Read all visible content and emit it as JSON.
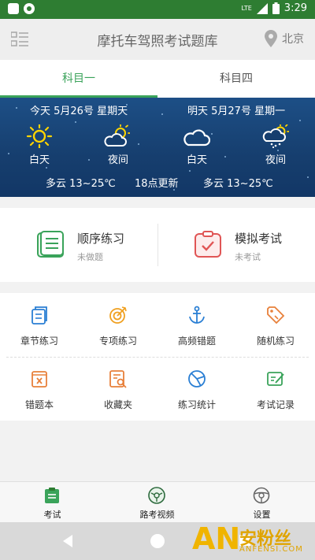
{
  "status_bar": {
    "time": "3:29",
    "network": "LTE"
  },
  "header": {
    "title": "摩托车驾照考试题库",
    "location": "北京"
  },
  "tabs": [
    {
      "label": "科目一",
      "active": true
    },
    {
      "label": "科目四",
      "active": false
    }
  ],
  "weather": {
    "today_header": "今天 5月26号 星期天",
    "tomorrow_header": "明天 5月27号 星期一",
    "labels": [
      "白天",
      "夜间",
      "白天",
      "夜间"
    ],
    "icons": [
      "sun-icon",
      "partly-cloudy-night-icon",
      "cloud-icon",
      "cloudy-rain-icon"
    ],
    "today_summary": "多云 13~25℃",
    "update_time": "18点更新",
    "tomorrow_summary": "多云 13~25℃"
  },
  "practice": {
    "sequential": {
      "title": "顺序练习",
      "subtitle": "未做题"
    },
    "mock_exam": {
      "title": "模拟考试",
      "subtitle": "未考试"
    }
  },
  "grid": [
    {
      "label": "章节练习",
      "icon": "chapter-practice-icon",
      "color": "#2a7fd4"
    },
    {
      "label": "专项练习",
      "icon": "target-icon",
      "color": "#f0a020"
    },
    {
      "label": "高频错题",
      "icon": "anchor-icon",
      "color": "#2a7fd4"
    },
    {
      "label": "随机练习",
      "icon": "tag-icon",
      "color": "#e8803a"
    },
    {
      "label": "错题本",
      "icon": "wrong-book-icon",
      "color": "#e8803a"
    },
    {
      "label": "收藏夹",
      "icon": "favorites-icon",
      "color": "#e8803a"
    },
    {
      "label": "练习统计",
      "icon": "statistics-icon",
      "color": "#2a7fd4"
    },
    {
      "label": "考试记录",
      "icon": "exam-record-icon",
      "color": "#3aa35a"
    }
  ],
  "bottom_nav": [
    {
      "label": "考试",
      "icon": "exam-icon",
      "active": true
    },
    {
      "label": "路考视频",
      "icon": "road-test-video-icon",
      "active": false
    },
    {
      "label": "设置",
      "icon": "settings-icon",
      "active": false
    }
  ],
  "watermark": {
    "brand_mark": "AN",
    "brand_cn": "安粉丝",
    "brand_en": "ANFENSI.COM"
  },
  "colors": {
    "accent": "#3aa35a",
    "status_bar": "#2e7d32",
    "weather_bg": "#1d4f86"
  }
}
